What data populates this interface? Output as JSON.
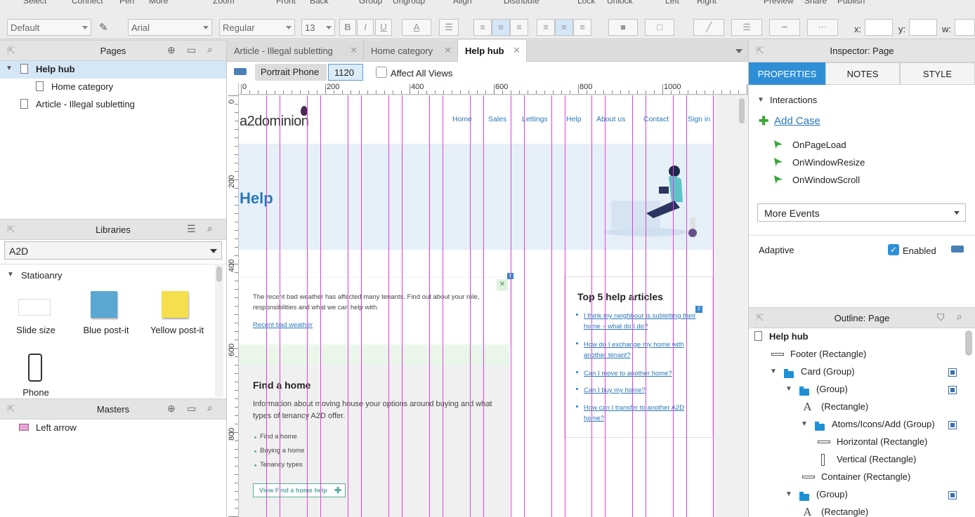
{
  "toolbar": {
    "top_labels": [
      "Select",
      "Connect",
      "Pen",
      "More",
      "Zoom",
      "Front",
      "Back",
      "Group",
      "Ungroup",
      "Align",
      "Distribute",
      "Lock",
      "Unlock",
      "Left",
      "Right",
      "Preview",
      "Share",
      "Publish"
    ],
    "style_value": "Default",
    "font_value": "Arial",
    "weight_value": "Regular",
    "size_value": "13",
    "bold": "B",
    "italic": "I",
    "underline": "U",
    "font_color": "A",
    "x_label": "x:",
    "y_label": "y:",
    "w_label": "w:"
  },
  "pages_panel": {
    "title": "Pages",
    "items": [
      {
        "label": "Help hub",
        "level": 0,
        "selected": true
      },
      {
        "label": "Home category",
        "level": 1,
        "selected": false
      },
      {
        "label": "Article - Illegal subletting",
        "level": 0,
        "selected": false
      }
    ]
  },
  "libraries_panel": {
    "title": "Libraries",
    "selected_library": "A2D",
    "group_label": "Statioanry",
    "items": [
      {
        "label": "Slide size",
        "color": "#ffffff"
      },
      {
        "label": "Blue post-it",
        "color": "#5aa7d4"
      },
      {
        "label": "Yellow post-it",
        "color": "#f5df4d"
      },
      {
        "label": "Phone",
        "color": "#333333"
      }
    ]
  },
  "masters_panel": {
    "title": "Masters",
    "items": [
      {
        "label": "Left arrow"
      }
    ]
  },
  "tabs": [
    {
      "label": "Article - Illegal subletting",
      "active": false
    },
    {
      "label": "Home category",
      "active": false
    },
    {
      "label": "Help hub",
      "active": true
    }
  ],
  "viewbar": {
    "view_name": "Portrait Phone",
    "view_width": "1120",
    "affect_all_label": "Affect All Views"
  },
  "ruler": {
    "top_ticks": [
      "0",
      "200",
      "400",
      "600",
      "800",
      "1000"
    ],
    "left_ticks": [
      "0",
      "200",
      "400",
      "600",
      "800"
    ]
  },
  "page": {
    "logo": "a2dominion",
    "nav": [
      "Home",
      "Sales",
      "Lettings",
      "Help",
      "About us",
      "Contact",
      "Sign in"
    ],
    "hero_title": "Help",
    "alert_text": "The recent bad weather has affected many tenants. Find out about your role, responsibilities and what we can help with.",
    "alert_link": "Recent bad weather",
    "alert_badge": "1",
    "top5_title": "Top 5 help articles",
    "top5_badge": "2",
    "top5_links": [
      "I think my neighbour is subletting their home – what do I do?",
      "How do I exchange my home with another tenant?",
      "Can I move to another home?",
      "Can I buy my home?",
      "How can I transfer to another A2D home?"
    ],
    "find_title": "Find a home",
    "find_text": "Information about moving house your options around buying and what types of tenancy A2D offer.",
    "find_bullets": [
      "Find a home",
      "Buying a home",
      "Tenancy types"
    ],
    "find_button": "View Find a home help",
    "accent_color": "#2a78b7",
    "guide_color": "#e040e0"
  },
  "inspector": {
    "title": "Inspector: Page",
    "tabs": [
      "PROPERTIES",
      "NOTES",
      "STYLE"
    ],
    "active_tab": "PROPERTIES",
    "interactions_label": "Interactions",
    "add_case": "Add Case",
    "events": [
      "OnPageLoad",
      "OnWindowResize",
      "OnWindowScroll"
    ],
    "more_events": "More Events",
    "adaptive_label": "Adaptive",
    "enabled_label": "Enabled"
  },
  "outline": {
    "title": "Outline: Page",
    "items": [
      {
        "label": "Help hub",
        "icon": "page",
        "indent": 0
      },
      {
        "label": "Footer (Rectangle)",
        "icon": "line",
        "indent": 1
      },
      {
        "label": "Card (Group)",
        "icon": "folder",
        "indent": 1
      },
      {
        "label": "(Group)",
        "icon": "folder",
        "indent": 2
      },
      {
        "label": "(Rectangle)",
        "icon": "text",
        "indent": 3
      },
      {
        "label": "Atoms/Icons/Add (Group)",
        "icon": "folder",
        "indent": 3
      },
      {
        "label": "Horizontal (Rectangle)",
        "icon": "line",
        "indent": 4
      },
      {
        "label": "Vertical (Rectangle)",
        "icon": "vline",
        "indent": 4
      },
      {
        "label": "Container (Rectangle)",
        "icon": "line",
        "indent": 3
      },
      {
        "label": "(Group)",
        "icon": "folder",
        "indent": 2
      },
      {
        "label": "(Rectangle)",
        "icon": "text",
        "indent": 3
      }
    ]
  }
}
